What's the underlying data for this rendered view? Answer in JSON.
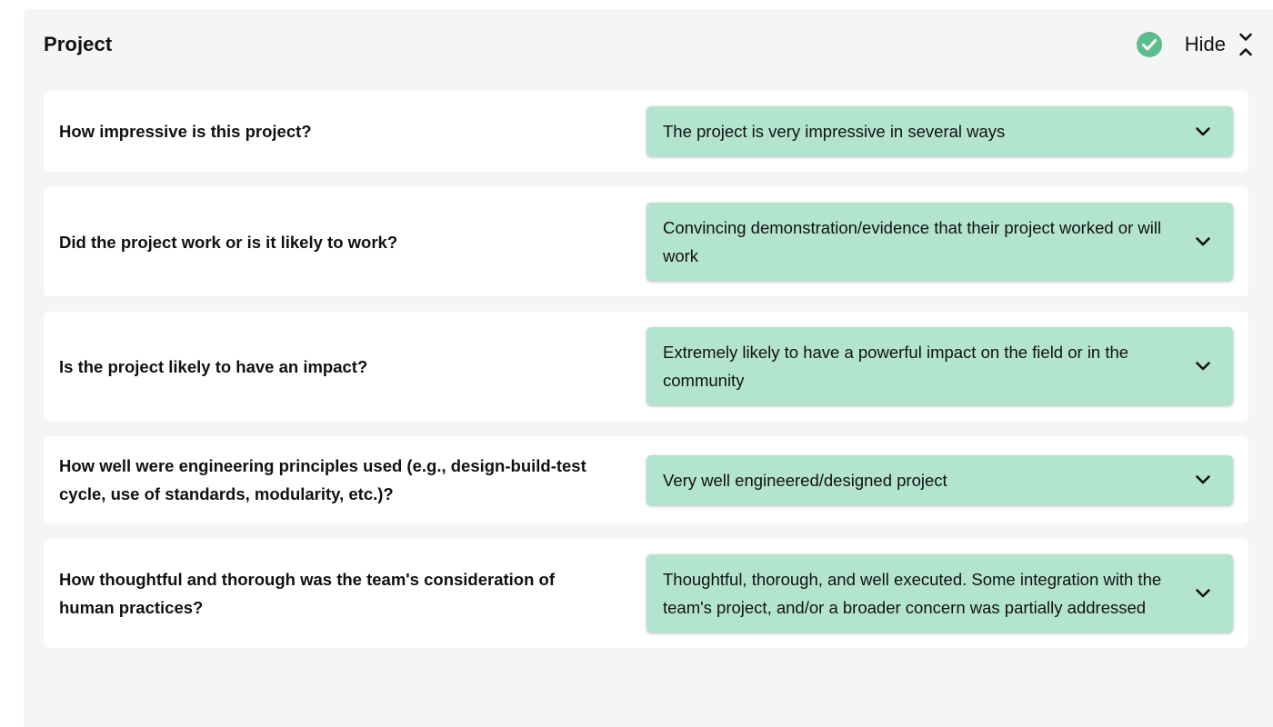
{
  "section": {
    "title": "Project",
    "hide_label": "Hide",
    "status_icon": "check-circle-icon",
    "status_color": "#5bbd8a",
    "accent_select_bg": "#b3e4cf"
  },
  "rows": [
    {
      "question": "How impressive is this project?",
      "answer": "The project is very impressive in several ways"
    },
    {
      "question": "Did the project work or is it likely to work?",
      "answer": "Convincing demonstration/evidence that their project worked or will work"
    },
    {
      "question": "Is the project likely to have an impact?",
      "answer": "Extremely likely to have a powerful impact on the field or in the community"
    },
    {
      "question": "How well were engineering principles used (e.g., design-build-test cycle, use of standards, modularity, etc.)?",
      "answer": "Very well engineered/designed project"
    },
    {
      "question": "How thoughtful and thorough was the team's consideration of human practices?",
      "answer": "Thoughtful, thorough, and well executed. Some integration with the team's project, and/or a broader concern was partially addressed"
    }
  ]
}
